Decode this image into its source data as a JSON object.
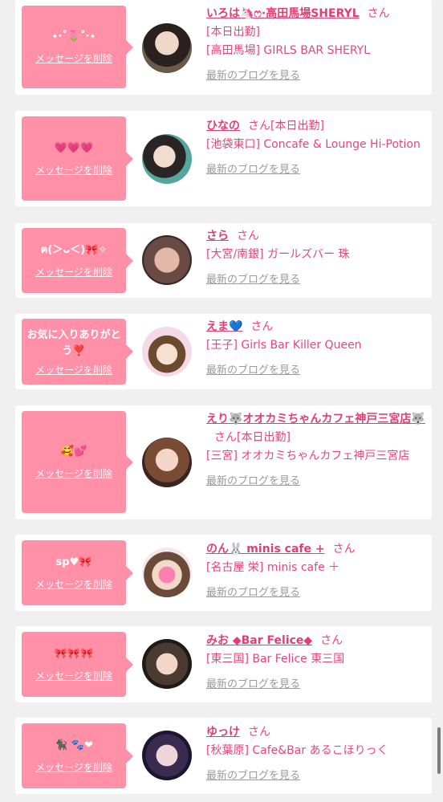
{
  "suffix": "さん",
  "delete_label": "メッセージを削除",
  "blog_label": "最新のブログを見る",
  "entries": [
    {
      "message": "⋆·˚🌷˚·⋆",
      "name": "いろは🦄ෆ·高田馬場SHERYL",
      "status": "[本日出勤]",
      "shop": "[高田馬場] GIRLS BAR SHERYL"
    },
    {
      "message": "💗💗💗",
      "name": "ひなの",
      "status": "[本日出勤]",
      "shop": "[池袋東口] Concafe & Lounge Hi-Potion"
    },
    {
      "message": "ฅ(＞ᴗ＜)🎀✧",
      "name": "さら",
      "status": "",
      "shop": "[大宮/南銀] ガールズバー 珠"
    },
    {
      "message": "お気に入りありがとう❣️",
      "name": "えま💙",
      "status": "",
      "shop": "[王子] Girls Bar Killer Queen"
    },
    {
      "message": "🥰💕",
      "name": "えり🐺オオカミちゃんカフェ神戸三宮店🐺",
      "status": "[本日出勤]",
      "shop": "[三宮] オオカミちゃんカフェ神戸三宮店"
    },
    {
      "message": "sp♥🎀",
      "name": "のん🐰 minis cafe +",
      "status": "",
      "shop": "[名古屋 栄] minis cafe ＋"
    },
    {
      "message": "🎀🎀🎀",
      "name": "みお ◆Bar Felice◆",
      "status": "",
      "shop": "[東三国] Bar Felice 東三国"
    },
    {
      "message": "🐈‍⬛ 🐾❤",
      "name": "ゆっけ",
      "status": "",
      "shop": "[秋葉原] Cafe&Bar あるこほりっく"
    }
  ]
}
